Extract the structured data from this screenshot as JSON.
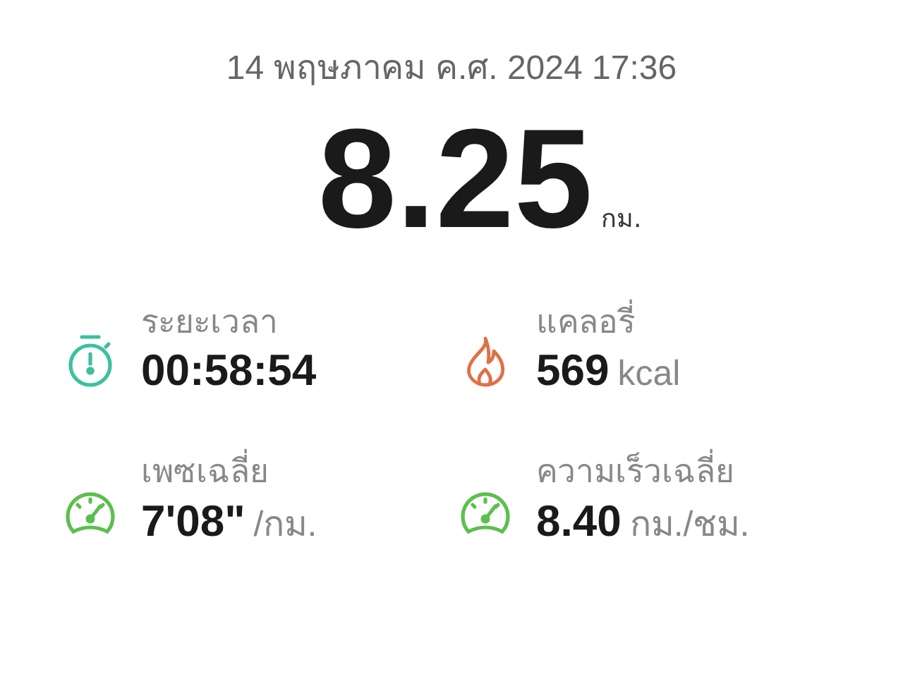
{
  "date": "14 พฤษภาคม ค.ศ. 2024 17:36",
  "distance": {
    "value": "8.25",
    "unit": "กม."
  },
  "stats": [
    {
      "kind": "duration",
      "label": "ระยะเวลา",
      "value": "00:58:54"
    },
    {
      "kind": "calories",
      "label": "แคลอรี่",
      "value": "569",
      "unit": "kcal"
    },
    {
      "kind": "pace",
      "label": "เพซเฉลี่ย",
      "value": "7'08\"",
      "unit": "/กม."
    },
    {
      "kind": "speed",
      "label": "ความเร็วเฉลี่ย",
      "value": "8.40",
      "unit": "กม./ชม."
    }
  ]
}
